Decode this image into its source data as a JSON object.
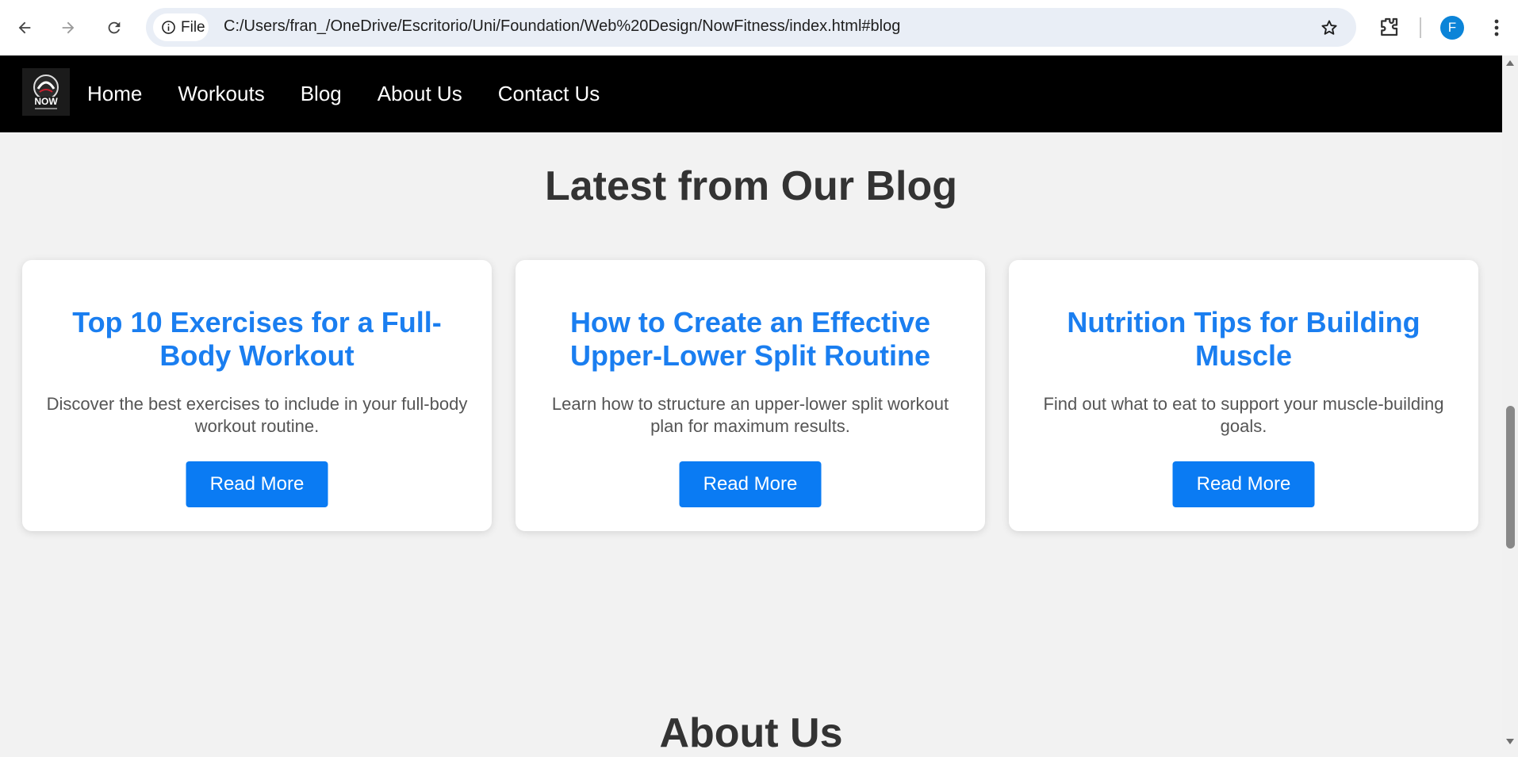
{
  "browser": {
    "site_info_label": "File",
    "url": "C:/Users/fran_/OneDrive/Escritorio/Uni/Foundation/Web%20Design/NowFitness/index.html#blog",
    "profile_initial": "F",
    "icons": [
      "back-icon",
      "forward-icon",
      "reload-icon",
      "info-icon",
      "star-icon",
      "extensions-icon",
      "menu-icon"
    ]
  },
  "header": {
    "logo_text": "NOW",
    "nav": [
      "Home",
      "Workouts",
      "Blog",
      "About Us",
      "Contact Us"
    ]
  },
  "blog": {
    "title": "Latest from Our Blog",
    "posts": [
      {
        "title": "Top 10 Exercises for a Full-Body Workout",
        "excerpt": "Discover the best exercises to include in your full-body workout routine.",
        "button": "Read More"
      },
      {
        "title": "How to Create an Effective Upper-Lower Split Routine",
        "excerpt": "Learn how to structure an upper-lower split workout plan for maximum results.",
        "button": "Read More"
      },
      {
        "title": "Nutrition Tips for Building Muscle",
        "excerpt": "Find out what to eat to support your muscle-building goals.",
        "button": "Read More"
      }
    ]
  },
  "about": {
    "title": "About Us"
  },
  "colors": {
    "accent": "#0a7bf3",
    "title_link": "#1a7ef0",
    "header_bg": "#000000",
    "page_bg": "#f2f2f2"
  }
}
